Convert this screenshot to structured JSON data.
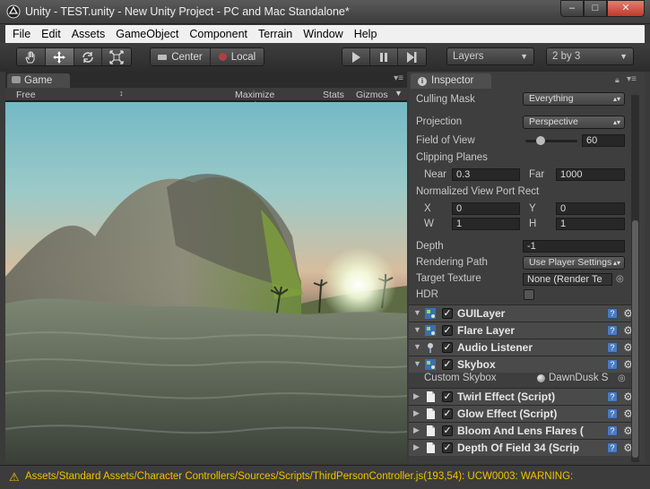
{
  "window": {
    "title": "Unity - TEST.unity - New Unity Project - PC and Mac Standalone*"
  },
  "menu": [
    "File",
    "Edit",
    "Assets",
    "GameObject",
    "Component",
    "Terrain",
    "Window",
    "Help"
  ],
  "toolbar": {
    "center_label": "Center",
    "local_label": "Local",
    "layers_label": "Layers",
    "layout_label": "2 by 3"
  },
  "game": {
    "tab_label": "Game",
    "aspect_label": "Free Aspect",
    "maximize_label": "Maximize on Play",
    "stats_label": "Stats",
    "gizmos_label": "Gizmos"
  },
  "inspector": {
    "tab_label": "Inspector",
    "camera": {
      "culling_mask_label": "Culling Mask",
      "culling_mask_value": "Everything",
      "projection_label": "Projection",
      "projection_value": "Perspective",
      "fov_label": "Field of View",
      "fov_value": "60",
      "clipping_label": "Clipping Planes",
      "near_label": "Near",
      "near_value": "0.3",
      "far_label": "Far",
      "far_value": "1000",
      "viewport_label": "Normalized View Port Rect",
      "x_label": "X",
      "x_value": "0",
      "y_label": "Y",
      "y_value": "0",
      "w_label": "W",
      "w_value": "1",
      "h_label": "H",
      "h_value": "1",
      "depth_label": "Depth",
      "depth_value": "-1",
      "rendering_path_label": "Rendering Path",
      "rendering_path_value": "Use Player Settings",
      "target_texture_label": "Target Texture",
      "target_texture_value": "None (Render Te",
      "hdr_label": "HDR"
    },
    "components": [
      {
        "name": "GUILayer",
        "icon": "guilayer-icon",
        "folded": true
      },
      {
        "name": "Flare Layer",
        "icon": "flare-layer-icon",
        "folded": true
      },
      {
        "name": "Audio Listener",
        "icon": "audio-listener-icon",
        "folded": true
      },
      {
        "name": "Skybox",
        "icon": "skybox-icon",
        "folded": false
      },
      {
        "name": "Twirl Effect (Script)",
        "icon": "script-icon",
        "folded": true
      },
      {
        "name": "Glow Effect (Script)",
        "icon": "script-icon",
        "folded": true
      },
      {
        "name": "Bloom And Lens Flares (",
        "icon": "script-icon",
        "folded": true
      },
      {
        "name": "Depth Of Field 34 (Scrip",
        "icon": "script-icon",
        "folded": true
      }
    ],
    "skybox": {
      "custom_label": "Custom Skybox",
      "value": "DawnDusk S"
    }
  },
  "status": {
    "message": "Assets/Standard Assets/Character Controllers/Sources/Scripts/ThirdPersonController.js(193,54): UCW0003: WARNING:"
  },
  "colors": {
    "warning": "#f0c000",
    "panel": "#3e3e3e",
    "accent_blue": "#4a7abf"
  }
}
